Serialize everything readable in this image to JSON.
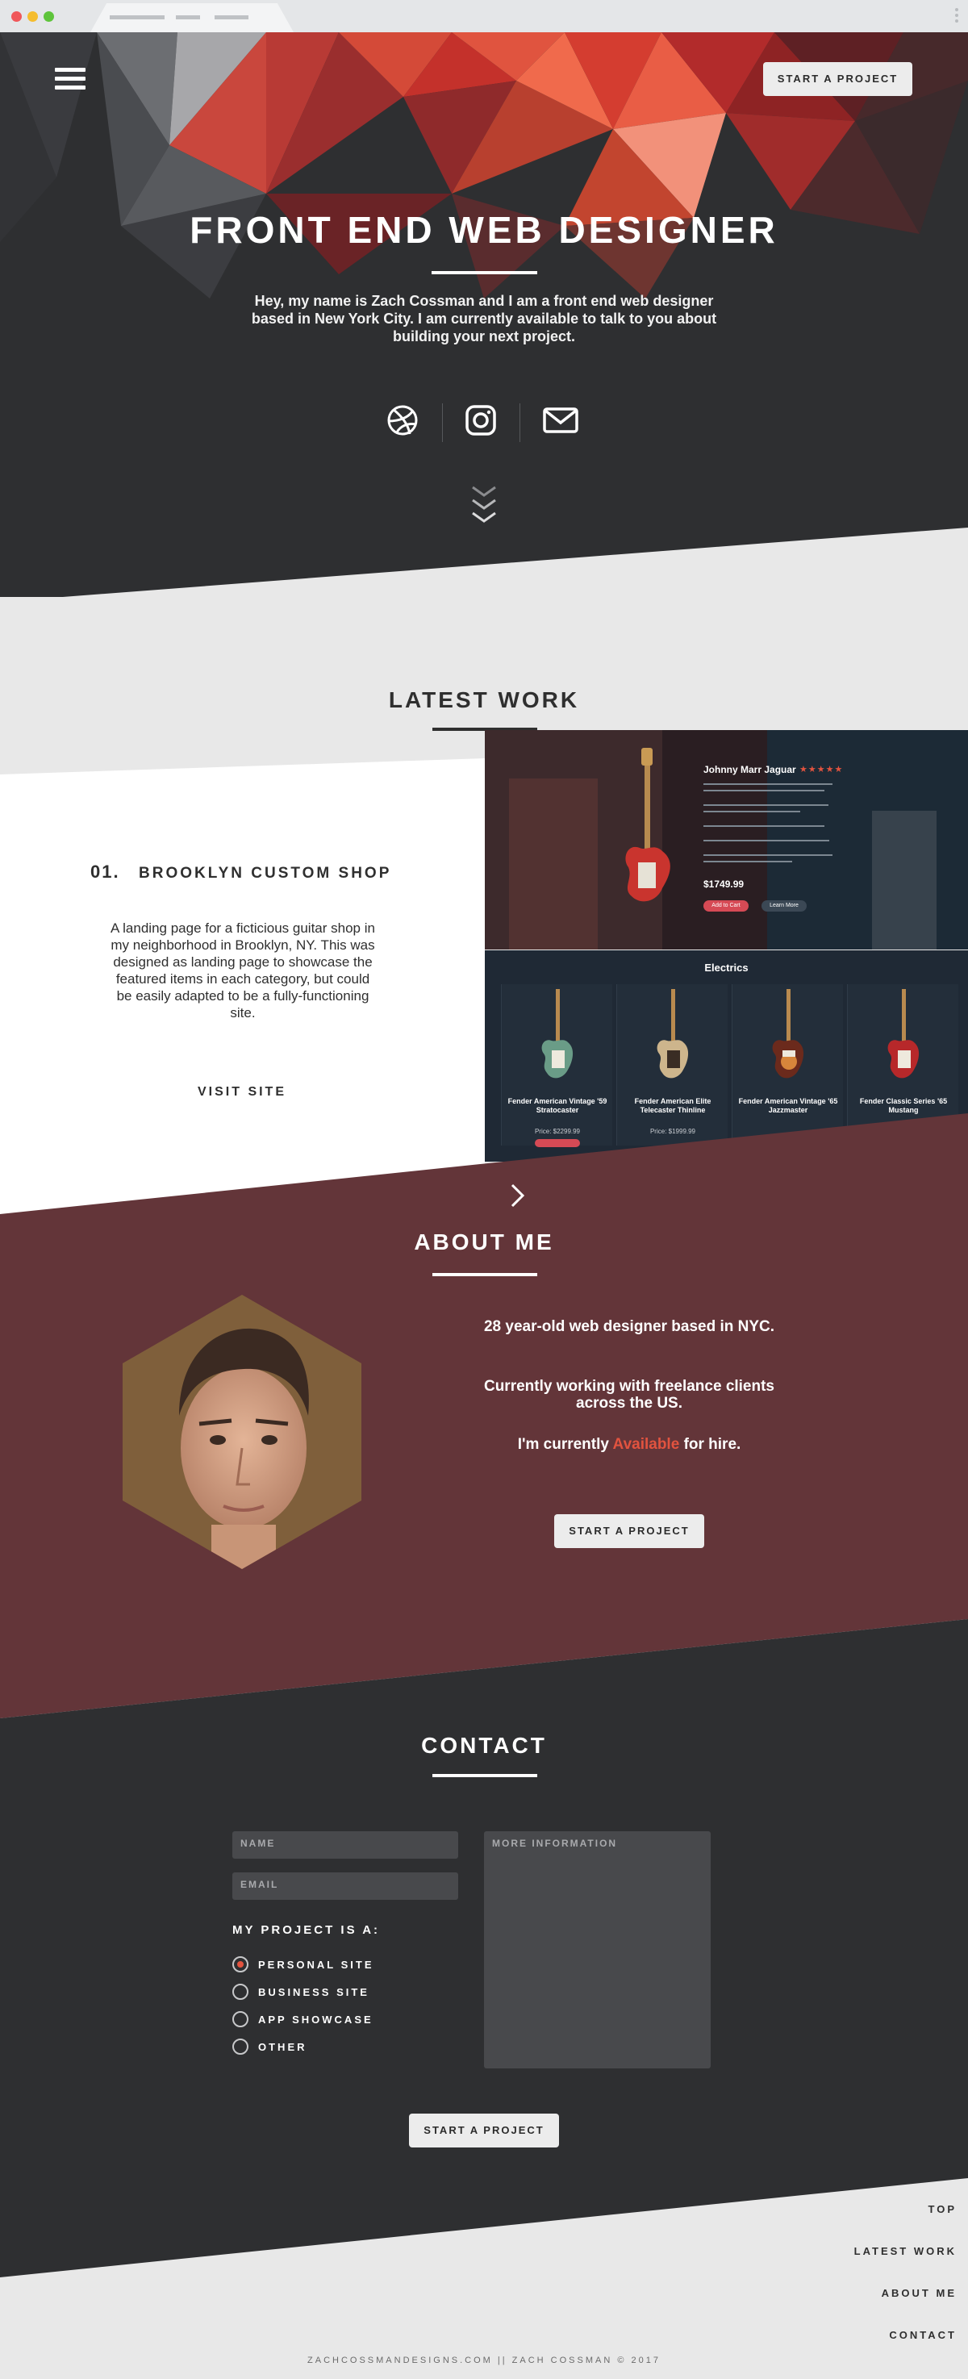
{
  "colors": {
    "dark": "#2e2f31",
    "light": "#e8e8e8",
    "maroon": "#633539",
    "accent": "#e2533f"
  },
  "header": {
    "menu_icon": "hamburger-icon",
    "cta_label": "START A PROJECT"
  },
  "hero": {
    "title": "FRONT END WEB DESIGNER",
    "description": "Hey, my name is Zach Cossman and I am a front end web designer based in New York City. I am currently available to talk to you about building your next project.",
    "social_icons": [
      "dribbble-icon",
      "instagram-icon",
      "mail-icon"
    ],
    "scroll_icon": "chevrons-down-icon"
  },
  "latest_work": {
    "title": "LATEST WORK",
    "number": "01.",
    "name": "BROOKLYN CUSTOM SHOP",
    "description": "A landing page for a ficticious guitar shop in my neighborhood in Brooklyn, NY. This was designed as landing page to showcase the featured items in each category, but could be easily adapted to be a fully-functioning site.",
    "visit_label": "VISIT SITE",
    "next_icon": "chevron-right-icon",
    "mockup": {
      "product_title": "Johnny Marr Jaguar",
      "product_price": "$1749.99",
      "add_to_cart": "Add to Cart",
      "learn_more": "Learn More",
      "category": "Electrics",
      "products": [
        {
          "name": "Fender American Vintage '59 Stratocaster",
          "price": "Price: $2299.99"
        },
        {
          "name": "Fender American Elite Telecaster Thinline",
          "price": "Price: $1999.99"
        },
        {
          "name": "Fender American Vintage '65 Jazzmaster",
          "price": ""
        },
        {
          "name": "Fender Classic Series '65 Mustang",
          "price": ""
        }
      ]
    }
  },
  "about": {
    "title": "ABOUT ME",
    "line1": "28 year-old web designer based in NYC.",
    "line2": "Currently working with freelance clients across the US.",
    "line3_prefix": "I'm currently",
    "line3_highlight": "Available",
    "line3_suffix": "for hire.",
    "cta_label": "START A PROJECT"
  },
  "contact": {
    "title": "CONTACT",
    "name_placeholder": "NAME",
    "email_placeholder": "EMAIL",
    "info_placeholder": "MORE INFORMATION",
    "project_label": "MY PROJECT IS A:",
    "options": [
      "PERSONAL SITE",
      "BUSINESS SITE",
      "APP SHOWCASE",
      "OTHER"
    ],
    "selected_option": "PERSONAL SITE",
    "submit_label": "START A PROJECT"
  },
  "footer": {
    "links": [
      "TOP",
      "LATEST WORK",
      "ABOUT ME",
      "CONTACT"
    ],
    "copyright": "ZACHCOSSMANDESIGNS.COM || ZACH COSSMAN © 2017"
  }
}
